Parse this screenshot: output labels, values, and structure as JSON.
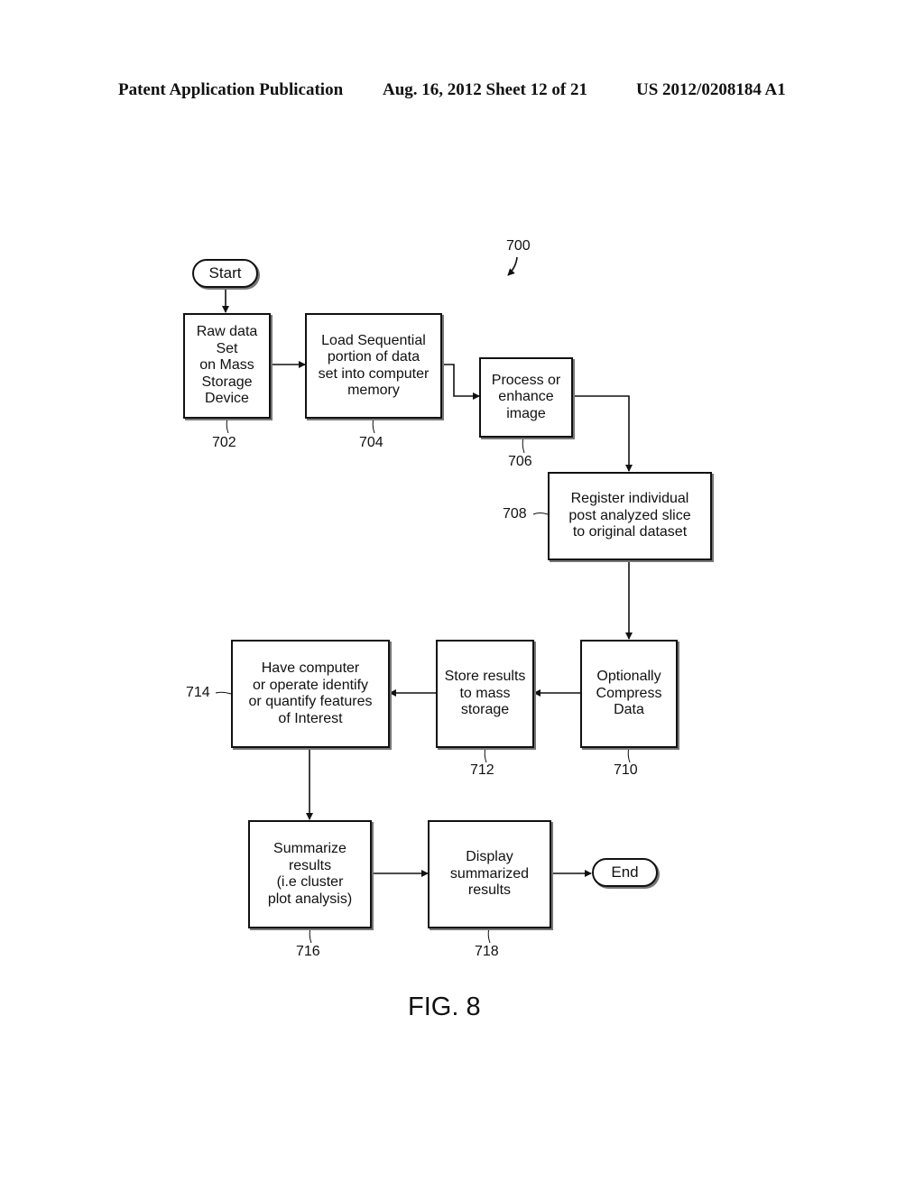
{
  "header": {
    "publication": "Patent Application Publication",
    "date_sheet": "Aug. 16, 2012  Sheet 12 of 21",
    "number": "US 2012/0208184 A1"
  },
  "figure": {
    "ref": "700",
    "caption": "FIG. 8"
  },
  "terminals": {
    "start": "Start",
    "end": "End"
  },
  "steps": {
    "s702": {
      "ref": "702",
      "text": "Raw data\nSet\non Mass\nStorage\nDevice"
    },
    "s704": {
      "ref": "704",
      "text": "Load Sequential\nportion of data\nset into computer\nmemory"
    },
    "s706": {
      "ref": "706",
      "text": "Process or\nenhance\nimage"
    },
    "s708": {
      "ref": "708",
      "text": "Register individual\npost analyzed slice\nto original dataset"
    },
    "s710": {
      "ref": "710",
      "text": "Optionally\nCompress\nData"
    },
    "s712": {
      "ref": "712",
      "text": "Store results\nto mass\nstorage"
    },
    "s714": {
      "ref": "714",
      "text": "Have computer\nor operate identify\nor quantify features\nof Interest"
    },
    "s716": {
      "ref": "716",
      "text": "Summarize\nresults\n(i.e cluster\nplot analysis)"
    },
    "s718": {
      "ref": "718",
      "text": "Display\nsummarized\nresults"
    }
  }
}
